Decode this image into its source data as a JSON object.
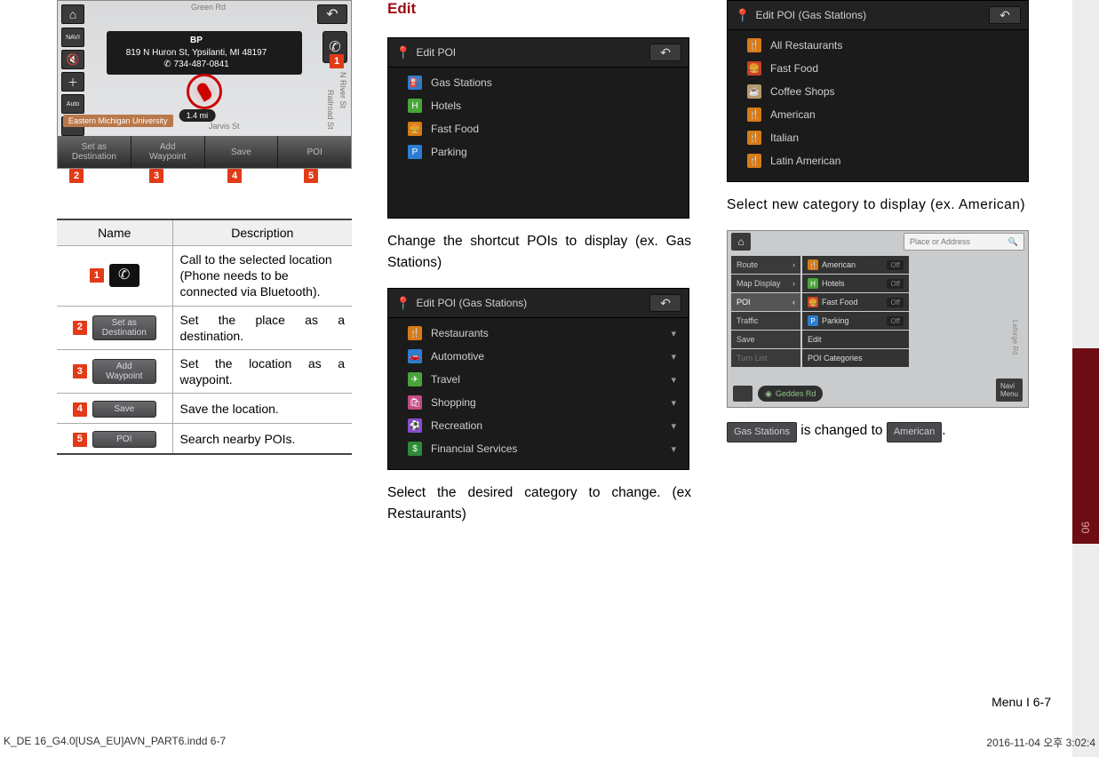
{
  "side_tab": "06",
  "footer": "Menu I 6-7",
  "print_left": "K_DE 16_G4.0[USA_EU]AVN_PART6.indd   6-7",
  "print_right": "2016-11-04   오후 3:02:4",
  "col1": {
    "map": {
      "callout_title": "BP",
      "callout_addr": "819 N Huron St, Ypsilanti, MI 48197",
      "callout_phone": "734-487-0841",
      "distance": "1.4 mi",
      "uni": "Eastern Michigan University",
      "road_green": "Green Rd",
      "road_jarvis": "Jarvis St",
      "road_nriver": "N River St",
      "road_railroad": "Railroad St",
      "left_auto": "Auto",
      "btn_set": "Set as\nDestination",
      "btn_add": "Add\nWaypoint",
      "btn_save": "Save",
      "btn_poi": "POI"
    },
    "markers": {
      "m1": "1",
      "m2": "2",
      "m3": "3",
      "m4": "4",
      "m5": "5"
    },
    "table": {
      "h_name": "Name",
      "h_desc": "Description",
      "rows": [
        {
          "num": "1",
          "chip": "phone",
          "desc": "Call to the selected location (Phone needs to be connected via Bluetooth)."
        },
        {
          "num": "2",
          "chip": "Set as\nDestination",
          "desc": "Set the place as a destination."
        },
        {
          "num": "3",
          "chip": "Add\nWaypoint",
          "desc": "Set the location as a waypoint."
        },
        {
          "num": "4",
          "chip": "Save",
          "desc": "Save the location."
        },
        {
          "num": "5",
          "chip": "POI",
          "desc": "Search nearby POIs."
        }
      ]
    }
  },
  "col2": {
    "heading": "Edit",
    "shot1": {
      "title": "Edit POI",
      "rows": [
        "Gas Stations",
        "Hotels",
        "Fast Food",
        "Parking"
      ]
    },
    "cap1": "Change the shortcut POIs to display (ex. Gas Stations)",
    "shot2": {
      "title": "Edit POI (Gas Stations)",
      "rows": [
        "Restaurants",
        "Automotive",
        "Travel",
        "Shopping",
        "Recreation",
        "Financial Services"
      ]
    },
    "cap2": "Select the desired category to change. (ex Restaurants)"
  },
  "col3": {
    "shot1": {
      "title": "Edit POI (Gas Stations)",
      "rows": [
        "All Restaurants",
        "Fast Food",
        "Coffee Shops",
        "American",
        "Italian",
        "Latin American"
      ]
    },
    "cap1": "Select new category to display (ex. American)",
    "menu": {
      "search_ph": "Place or Address",
      "left": [
        "Route",
        "Map Display",
        "POI",
        "Traffic",
        "Save",
        "Turn List"
      ],
      "mid": [
        {
          "label": "American",
          "ico": "c-orange",
          "off": true
        },
        {
          "label": "Hotels",
          "ico": "c-green",
          "off": true
        },
        {
          "label": "Fast Food",
          "ico": "c-red",
          "off": true
        },
        {
          "label": "Parking",
          "ico": "c-blue",
          "off": true
        },
        {
          "label": "Edit",
          "ico": "",
          "off": false
        },
        {
          "label": "POI Categories",
          "ico": "",
          "off": false
        }
      ],
      "geddes": "Geddes Rd",
      "navi": "Navi\nMenu"
    },
    "sentence_a": "Gas Stations",
    "sentence_mid": " is changed to ",
    "sentence_b": "American",
    "sentence_end": "."
  }
}
